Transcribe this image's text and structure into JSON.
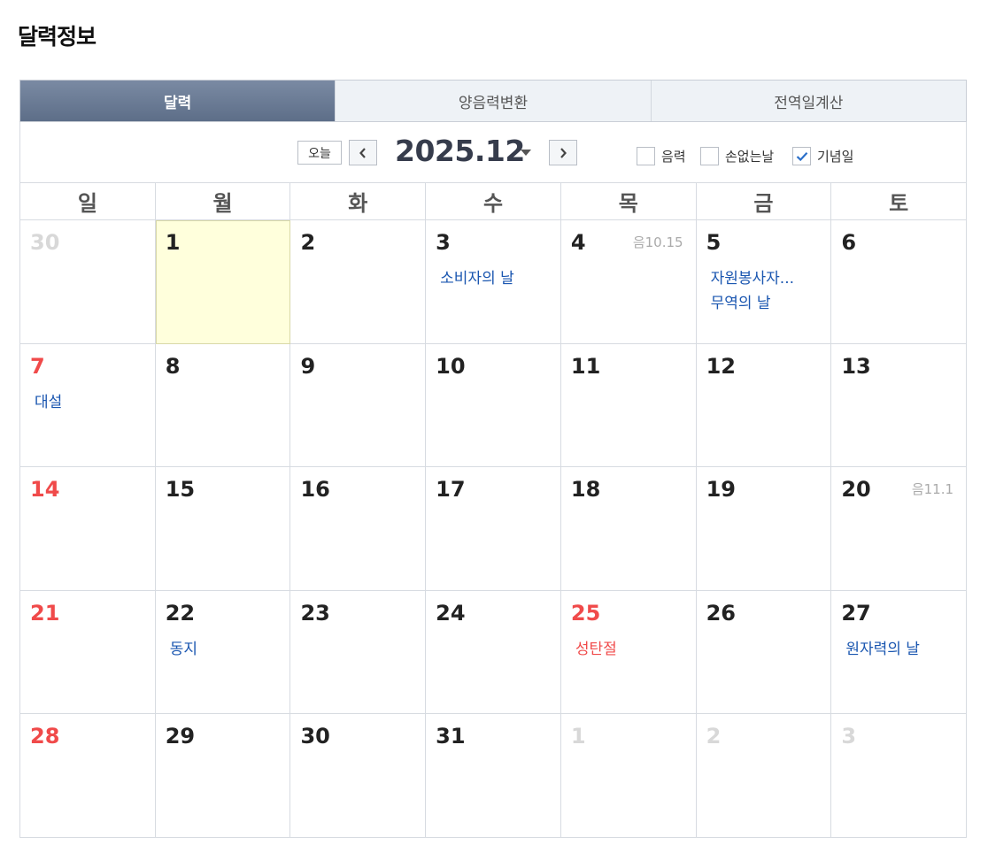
{
  "page_title": "달력정보",
  "tabs": [
    "달력",
    "양음력변환",
    "전역일계산"
  ],
  "toolbar": {
    "today": "오늘",
    "month": "2025.12",
    "options": [
      {
        "label": "음력",
        "checked": false
      },
      {
        "label": "손없는날",
        "checked": false
      },
      {
        "label": "기념일",
        "checked": true
      }
    ]
  },
  "weekdays": [
    "일",
    "월",
    "화",
    "수",
    "목",
    "금",
    "토"
  ],
  "weeks": [
    [
      {
        "day": "30",
        "other": true
      },
      {
        "day": "1",
        "today": true
      },
      {
        "day": "2"
      },
      {
        "day": "3",
        "events": [
          "소비자의 날"
        ]
      },
      {
        "day": "4",
        "lunar": "음10.15"
      },
      {
        "day": "5",
        "events": [
          "자원봉사자...",
          "무역의 날"
        ]
      },
      {
        "day": "6"
      }
    ],
    [
      {
        "day": "7",
        "events": [
          "대설"
        ]
      },
      {
        "day": "8"
      },
      {
        "day": "9"
      },
      {
        "day": "10"
      },
      {
        "day": "11"
      },
      {
        "day": "12"
      },
      {
        "day": "13"
      }
    ],
    [
      {
        "day": "14"
      },
      {
        "day": "15"
      },
      {
        "day": "16"
      },
      {
        "day": "17"
      },
      {
        "day": "18"
      },
      {
        "day": "19"
      },
      {
        "day": "20",
        "lunar": "음11.1"
      }
    ],
    [
      {
        "day": "21"
      },
      {
        "day": "22",
        "events": [
          "동지"
        ]
      },
      {
        "day": "23"
      },
      {
        "day": "24"
      },
      {
        "day": "25",
        "holiday": true,
        "events": [
          "성탄절"
        ]
      },
      {
        "day": "26"
      },
      {
        "day": "27",
        "events": [
          "원자력의 날"
        ]
      }
    ],
    [
      {
        "day": "28"
      },
      {
        "day": "29"
      },
      {
        "day": "30"
      },
      {
        "day": "31"
      },
      {
        "day": "1",
        "other": true
      },
      {
        "day": "2",
        "other": true
      },
      {
        "day": "3",
        "other": true
      }
    ]
  ],
  "colors": {
    "holiday": "#f04a4a",
    "event": "#1a56b0",
    "today_bg": "#ffffdc",
    "active_tab": "#6a7b96"
  }
}
